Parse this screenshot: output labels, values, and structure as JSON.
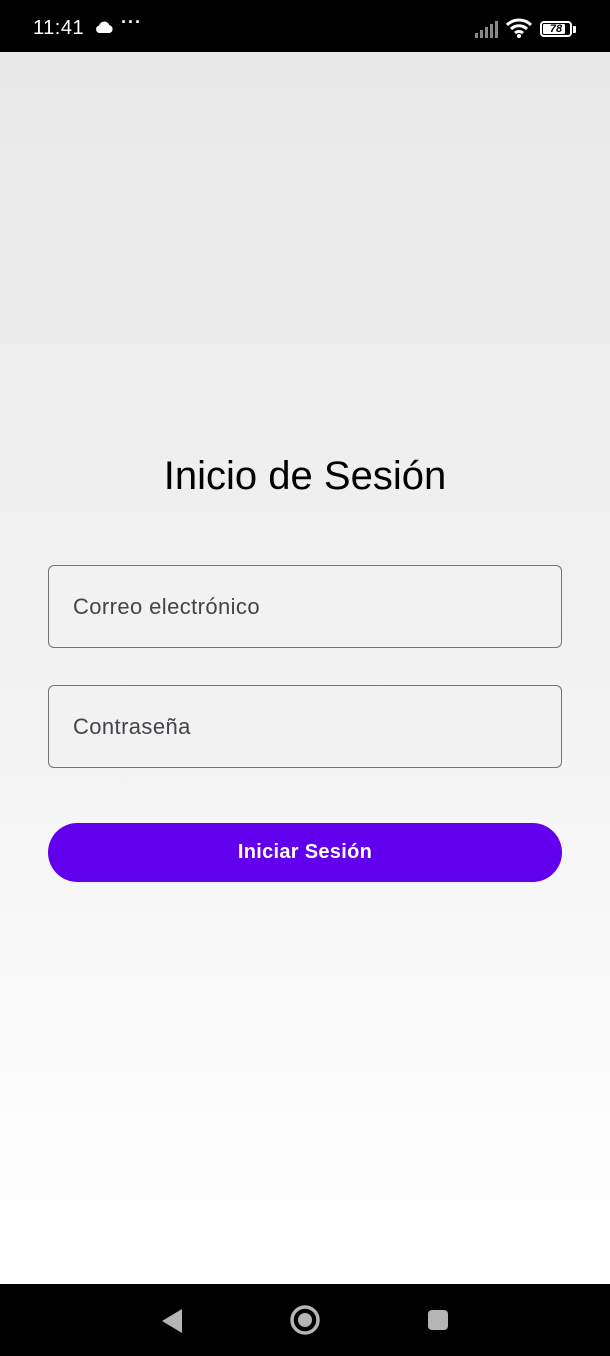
{
  "status_bar": {
    "time": "11:41",
    "overflow_dots": "···",
    "battery_level": "78",
    "icons": [
      "cloud-icon",
      "signal-icon",
      "wifi-icon",
      "battery-icon"
    ]
  },
  "login": {
    "title": "Inicio de Sesión",
    "email_placeholder": "Correo electrónico",
    "email_value": "",
    "password_placeholder": "Contraseña",
    "password_value": "",
    "submit_label": "Iniciar Sesión"
  },
  "nav_bar": {
    "icons": [
      "back-icon",
      "home-icon",
      "recents-icon"
    ]
  },
  "colors": {
    "accent": "#6200ee",
    "field_border": "#74727a",
    "text_primary": "#000000",
    "text_secondary": "#45434a"
  }
}
